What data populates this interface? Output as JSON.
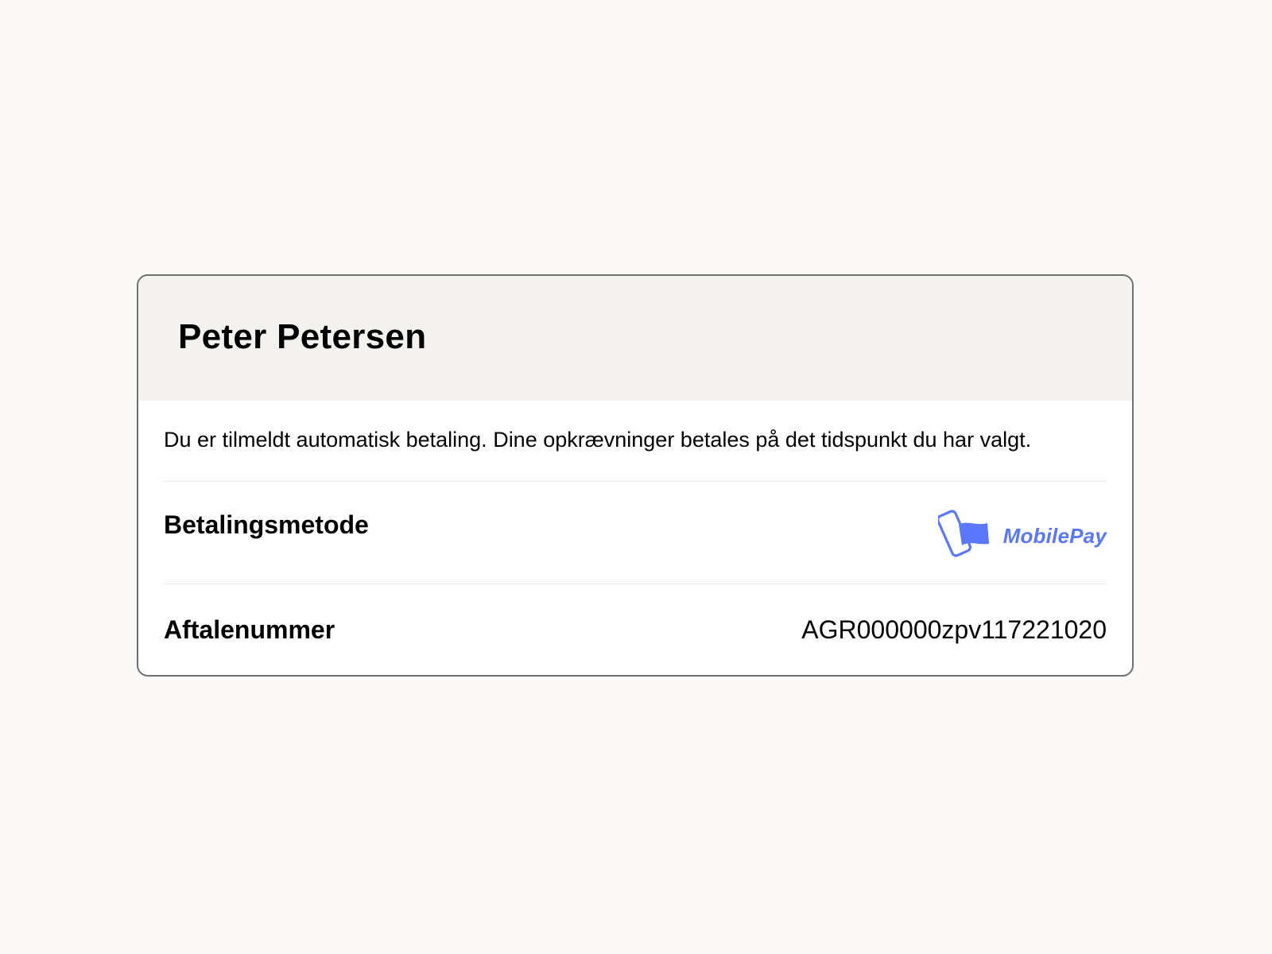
{
  "card": {
    "title": "Peter Petersen",
    "notice": "Du er tilmeldt automatisk betaling. Dine opkrævninger betales på det tidspunkt du har valgt.",
    "payment_method": {
      "label": "Betalingsmetode",
      "logo_icon": "mobilepay-logo-icon",
      "logo_text": "MobilePay",
      "logo_color": "#5A78FF"
    },
    "agreement": {
      "label": "Aftalenummer",
      "value": "AGR000000zpv117221020"
    }
  },
  "colors": {
    "page_background": "#FAF9F7",
    "header_background": "#F4F2EE",
    "border": "#6F6F6F"
  }
}
